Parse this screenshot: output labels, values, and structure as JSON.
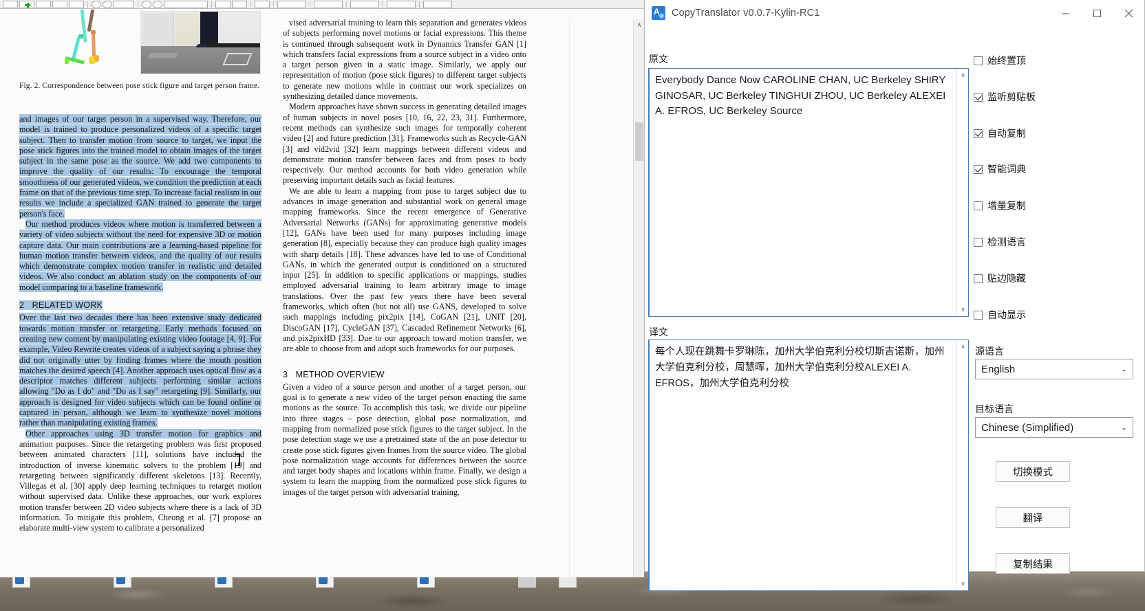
{
  "desktop": {
    "icon_count": 7
  },
  "pdf_reader": {
    "toolbar_buttons": [
      "save-icon",
      "add-icon",
      "keyboard-icon",
      "print-icon",
      "fit-icon",
      "rotate-left-icon",
      "rotate-right-icon",
      "page-field",
      "zoom-out-icon",
      "zoom-in-icon",
      "zoom-field",
      "pan-icon",
      "select-icon",
      "snapshot-icon"
    ],
    "scrollbar": {
      "up_arrow": "∧",
      "down_arrow": "∨"
    },
    "figure": {
      "caption": "Fig. 2.  Correspondence between pose stick figure and target person frame."
    },
    "left_column": {
      "para1": "and images of our target person in a supervised way. Therefore, our model is trained to produce personalized videos of a specific target subject. Then to transfer motion from source to target, we input the pose stick figures into the trained model to obtain images of the target subject in the same pose as the source. We add two components to improve the quality of our results: To encourage the temporal smoothness of our generated videos, we condition the prediction at each frame on that of the previous time step. To increase facial realism in our results we include a specialized GAN trained to generate the target person's face.",
      "para2": "Our method produces videos where motion is transferred between a variety of video subjects without the need for expensive 3D or motion capture data. Our main contributions are a learning-based pipeline for human motion transfer between videos, and the quality of our results which demonstrate complex motion transfer in realistic and detailed videos. We also conduct an ablation study on the components of our model comparing to a baseline framework.",
      "section_number": "2",
      "section_title": "RELATED WORK",
      "para3": "Over the last two decades there has been extensive study dedicated towards motion transfer or retargeting. Early methods focused on creating new content by manipulating existing video footage [4, 9]. For example, Video Rewrite creates videos of a subject saying a phrase they did not originally utter by finding frames where the mouth position matches the desired speech [4]. Another approach uses optical flow as a descriptor matches different subjects performing similar actions allowing \"Do as I do\" and \"Do as I say\" retargeting [9]. Similarly, our approach is designed for video subjects which can be found online or captured in person, although we learn to synthesize novel motions rather than manipulating existing frames.",
      "para4_sel": "Other approaches using 3D transfer motion for graphics and",
      "para4_rest": " animation purposes. Since the retargeting problem was first proposed between animated characters [11], solutions have included the introduction of inverse kinematic solvers to the problem [19] and retargeting between significantly different skeletons [13]. Recently, Villegas et al. [30] apply deep learning techniques to retarget motion without supervised data. Unlike these approaches, our work explores motion transfer between 2D video subjects where there is a lack of 3D information. To mitigate this problem, Cheung et al. [7] propose an elaborate multi-view system to calibrate a personalized"
    },
    "middle_column": {
      "para1": "vised adversarial training to learn this separation and generates videos of subjects performing novel motions or facial expressions. This theme is continued through subsequent work in Dynamics Transfer GAN [1] which transfers facial expressions from a source subject in a video onto a target person given in a static image. Similarly, we apply our representation of motion (pose stick figures) to different target subjects to generate new motions while in contrast our work specializes on synthesizing detailed dance movements.",
      "para2": "Modern approaches have shown success in generating detailed images of human subjects in novel poses [10, 16, 22, 23, 31]. Furthermore, recent methods can synthesize such images for temporally coherent video [2] and future prediction [31]. Frameworks such as Recycle-GAN [3] and vid2vid [32] learn mappings between different videos and demonstrate motion transfer between faces and from poses to body respectively. Our method accounts for both video generation while preserving important details such as facial features.",
      "para3": "We are able to learn a mapping from pose to target subject due to advances in image generation and substantial work on general image mapping frameworks. Since the recent emergence of Generative Adversarial Networks (GANs) for approximating generative models [12], GANs have been used for many purposes including image generation [8], especially because they can produce high quality images with sharp details [18]. These advances have led to use of Conditional GANs, in which the generated output is conditioned on a structured input [25]. In addition to specific applications or mappings, studies employed adversarial training to learn arbitrary image to image translations. Over the past few years there have been several frameworks, which often (but not all) use GANS, developed to solve such mappings including pix2pix [14], CoGAN [21], UNIT [20], DiscoGAN [17], CycleGAN [37], Cascaded Refinement Networks [6], and pix2pixHD [33]. Due to our approach toward motion transfer, we are able to choose from and adopt such frameworks for our purposes.",
      "section_number": "3",
      "section_title": "METHOD OVERVIEW",
      "para4": "Given a video of a source person and another of a target person, our goal is to generate a new video of the target person enacting the same motions as the source. To accomplish this task, we divide our pipeline into three stages – pose detection, global pose normalization, and mapping from normalized pose stick figures to the target subject. In the pose detection stage we use a pretrained state of the art pose detector to create pose stick figures given frames from the source video. The global pose normalization stage accounts for differences between the source and target body shapes and locations within frame. Finally, we design a system to learn the mapping from the normalized pose stick figures to images of the target person with adversarial training."
    }
  },
  "copytranslator": {
    "title": "CopyTranslator v0.0.7-Kylin-RC1",
    "app_icon": "copytranslator-icon",
    "window_controls": {
      "minimize": "minimize-icon",
      "maximize": "maximize-icon",
      "close": "close-icon"
    },
    "source_label": "原文",
    "source_text": "Everybody Dance Now CAROLINE CHAN, UC Berkeley SHIRY GINOSAR, UC Berkeley TINGHUI ZHOU, UC Berkeley ALEXEI A. EFROS, UC Berkeley Source",
    "target_label": "译文",
    "target_text": "每个人现在跳舞卡罗琳陈，加州大学伯克利分校切斯吉诺斯，加州大学伯克利分校，周慧晖，加州大学伯克利分校ALEXEI A. EFROS，加州大学伯克利分校",
    "scroll_up": "∧",
    "scroll_down": "∨",
    "options": [
      {
        "label": "始终置顶",
        "checked": false,
        "name": "always-on-top"
      },
      {
        "label": "监听剪贴板",
        "checked": true,
        "name": "listen-clipboard"
      },
      {
        "label": "自动复制",
        "checked": true,
        "name": "auto-copy"
      },
      {
        "label": "智能词典",
        "checked": true,
        "name": "smart-dictionary"
      },
      {
        "label": "增量复制",
        "checked": false,
        "name": "incremental-copy"
      },
      {
        "label": "检测语言",
        "checked": false,
        "name": "detect-language"
      },
      {
        "label": "贴边隐藏",
        "checked": false,
        "name": "edge-hide"
      },
      {
        "label": "自动显示",
        "checked": false,
        "name": "auto-show"
      }
    ],
    "source_lang_label": "源语言",
    "source_lang_value": "English",
    "target_lang_label": "目标语言",
    "target_lang_value": "Chinese (Simplified)",
    "select_caret": "⌄",
    "buttons": [
      {
        "label": "切换模式",
        "name": "switch-mode-button"
      },
      {
        "label": "翻译",
        "name": "translate-button"
      },
      {
        "label": "复制结果",
        "name": "copy-result-button"
      }
    ]
  }
}
